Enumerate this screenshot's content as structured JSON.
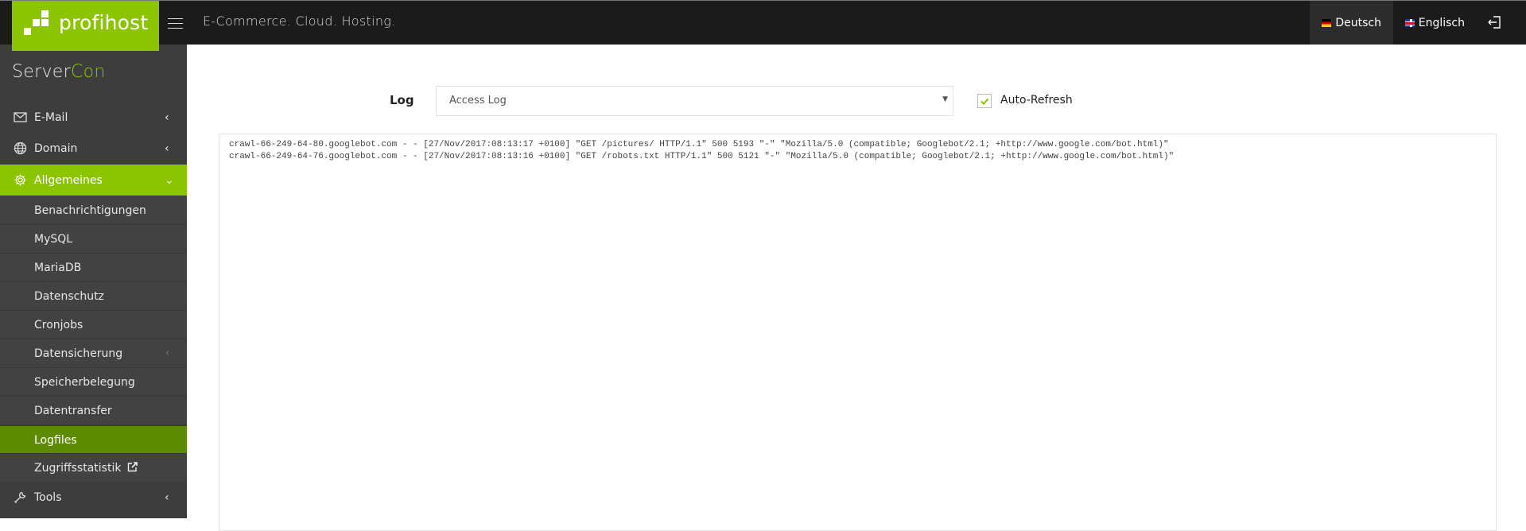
{
  "header": {
    "logo_text": "profihost",
    "tagline": "E-Commerce. Cloud. Hosting.",
    "languages": [
      {
        "label": "Deutsch",
        "flag": "flag-de-icon",
        "active": true
      },
      {
        "label": "Englisch",
        "flag": "flag-gb-icon",
        "active": false
      }
    ],
    "logout_icon": "logout-icon",
    "menu_icon": "hamburger-icon"
  },
  "sidebar": {
    "brand_main": "Server",
    "brand_accent": "Con",
    "items": [
      {
        "label": "E-Mail",
        "icon": "envelope-icon",
        "chevron": "‹"
      },
      {
        "label": "Domain",
        "icon": "globe-icon",
        "chevron": "‹"
      },
      {
        "label": "Allgemeines",
        "icon": "gear-icon",
        "chevron": "⌄",
        "open": true
      },
      {
        "label": "Tools",
        "icon": "wrench-icon",
        "chevron": "‹"
      }
    ],
    "subitems": [
      {
        "label": "Benachrichtigungen"
      },
      {
        "label": "MySQL"
      },
      {
        "label": "MariaDB"
      },
      {
        "label": "Datenschutz"
      },
      {
        "label": "Cronjobs"
      },
      {
        "label": "Datensicherung",
        "chevron": "‹"
      },
      {
        "label": "Speicherbelegung"
      },
      {
        "label": "Datentransfer"
      },
      {
        "label": "Logfiles",
        "active": true
      },
      {
        "label": "Zugriffsstatistik",
        "external": true
      }
    ]
  },
  "main": {
    "log_label": "Log",
    "log_select_value": "Access Log",
    "auto_refresh_label": "Auto-Refresh",
    "auto_refresh_checked": true,
    "log_lines": [
      "crawl-66-249-64-80.googlebot.com - - [27/Nov/2017:08:13:17 +0100] \"GET /pictures/ HTTP/1.1\" 500 5193 \"-\" \"Mozilla/5.0 (compatible; Googlebot/2.1; +http://www.google.com/bot.html)\"",
      "crawl-66-249-64-76.googlebot.com - - [27/Nov/2017:08:13:16 +0100] \"GET /robots.txt HTTP/1.1\" 500 5121 \"-\" \"Mozilla/5.0 (compatible; Googlebot/2.1; +http://www.google.com/bot.html)\""
    ]
  },
  "colors": {
    "brand_green": "#8dc400",
    "active_green": "#5e8a00",
    "header_bg": "#1b1b1b",
    "sidebar_bg": "#3d3d3d"
  }
}
